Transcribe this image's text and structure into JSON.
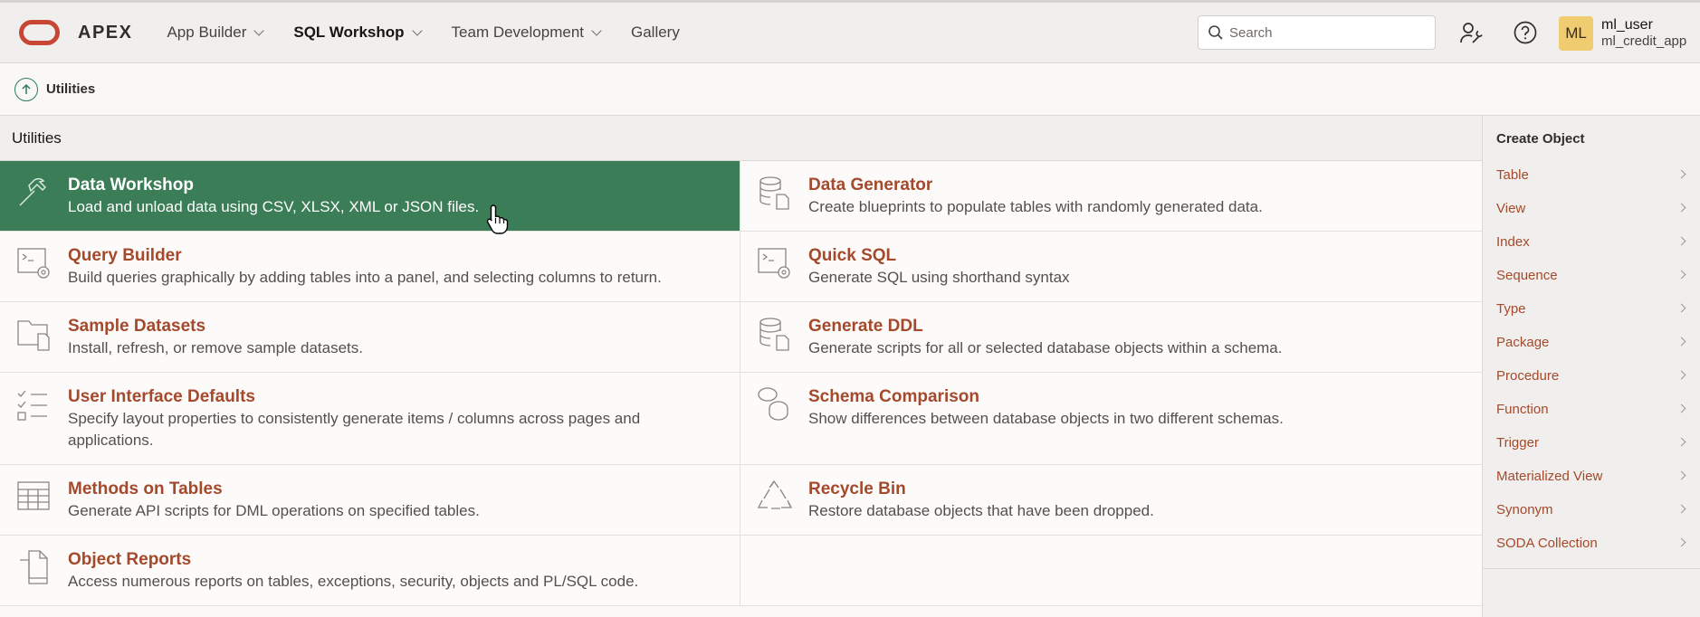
{
  "header": {
    "brand": "APEX",
    "nav": [
      {
        "label": "App Builder",
        "has_menu": true,
        "active": false
      },
      {
        "label": "SQL Workshop",
        "has_menu": true,
        "active": true
      },
      {
        "label": "Team Development",
        "has_menu": true,
        "active": false
      },
      {
        "label": "Gallery",
        "has_menu": false,
        "active": false
      }
    ],
    "search": {
      "placeholder": "Search",
      "value": ""
    },
    "user": {
      "initials": "ML",
      "name": "ml_user",
      "workspace": "ml_credit_app"
    }
  },
  "breadcrumb": {
    "label": "Utilities"
  },
  "region": {
    "title": "Utilities"
  },
  "cards": [
    {
      "title": "Data Workshop",
      "desc": "Load and unload data using CSV, XLSX, XML or JSON files.",
      "icon": "hammer-icon"
    },
    {
      "title": "Data Generator",
      "desc": "Create blueprints to populate tables with randomly generated data.",
      "icon": "database-doc-icon"
    },
    {
      "title": "Query Builder",
      "desc": "Build queries graphically by adding tables into a panel, and selecting columns to return.",
      "icon": "terminal-gear-icon"
    },
    {
      "title": "Quick SQL",
      "desc": "Generate SQL using shorthand syntax",
      "icon": "terminal-gear-icon"
    },
    {
      "title": "Sample Datasets",
      "desc": "Install, refresh, or remove sample datasets.",
      "icon": "folder-doc-icon"
    },
    {
      "title": "Generate DDL",
      "desc": "Generate scripts for all or selected database objects within a schema.",
      "icon": "database-doc-icon"
    },
    {
      "title": "User Interface Defaults",
      "desc": "Specify layout properties to consistently generate items / columns across pages and applications.",
      "icon": "checklist-icon"
    },
    {
      "title": "Schema Comparison",
      "desc": "Show differences between database objects in two different schemas.",
      "icon": "compare-databases-icon"
    },
    {
      "title": "Methods on Tables",
      "desc": "Generate API scripts for DML operations on specified tables.",
      "icon": "table-grid-icon"
    },
    {
      "title": "Recycle Bin",
      "desc": "Restore database objects that have been dropped.",
      "icon": "recycle-icon"
    },
    {
      "title": "Object Reports",
      "desc": "Access numerous reports on tables, exceptions, security, objects and PL/SQL code.",
      "icon": "documents-icon"
    }
  ],
  "side_panel": {
    "title": "Create Object",
    "items": [
      "Table",
      "View",
      "Index",
      "Sequence",
      "Type",
      "Package",
      "Procedure",
      "Function",
      "Trigger",
      "Materialized View",
      "Synonym",
      "SODA Collection"
    ]
  },
  "colors": {
    "brand_red": "#c74634",
    "active_green": "#3a7d56",
    "link_orange": "#a4492b",
    "avatar_yellow": "#f0cc71"
  }
}
